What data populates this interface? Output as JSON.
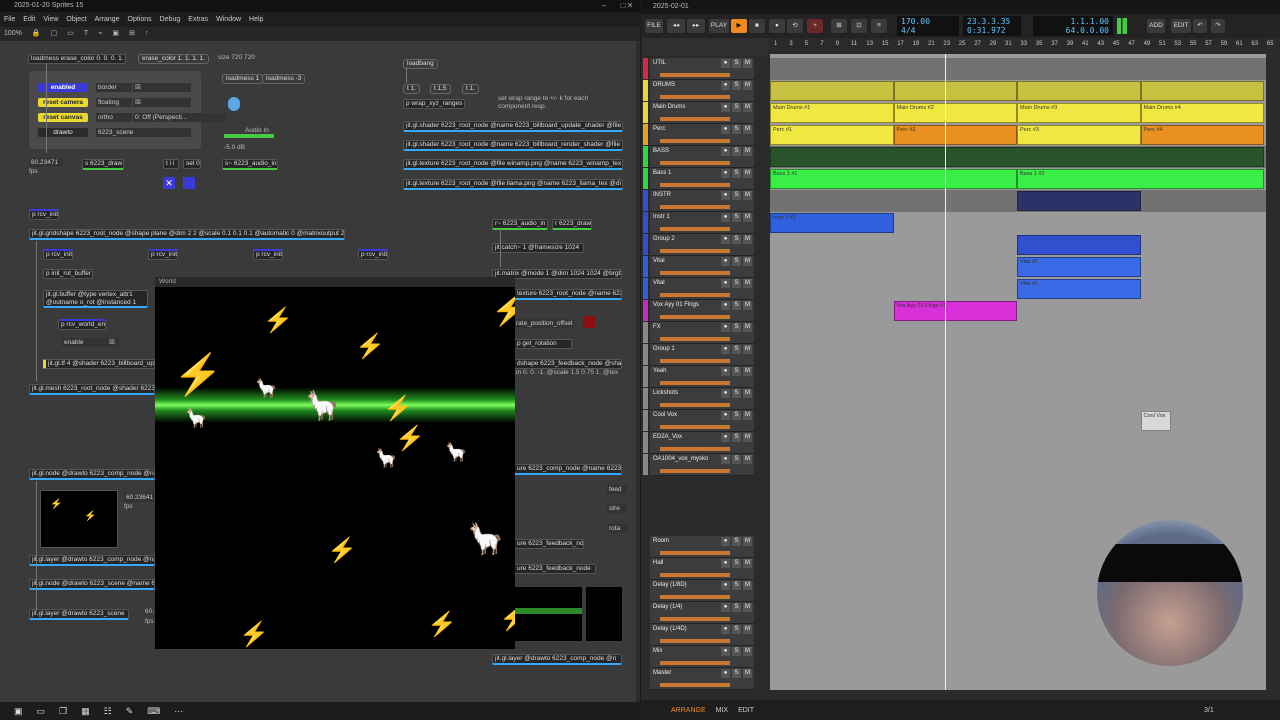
{
  "max": {
    "title": "2025-01-20 Sprites 15",
    "menu": [
      "File",
      "Edit",
      "View",
      "Object",
      "Arrange",
      "Options",
      "Debug",
      "Extras",
      "Window",
      "Help"
    ],
    "zoom": "100%",
    "objects": {
      "loadmess_erase": "loadmess erase_color 0. 0. 0. 1.",
      "erase_color": "erase_color 1. 1. 1. 1.",
      "size": "size 720 720",
      "loadmess1": "loadmess 1",
      "loadmess3": "loadmess -3",
      "loadbang": "loadbang",
      "rng1": "t 1.",
      "rng15": "t 1.5",
      "rng1b": "t 1.",
      "p_wrap": "p wrap_xyz_ranges",
      "wrap_comment": "set wrap range to +/- k for each component resp.",
      "shader_update": "jit.gl.shader 6223_root_node @name 6223_billboard_update_shader @file b",
      "shader_render": "jit.gl.shader 6223_root_node @name 6223_billboard_render_shader @file b",
      "texture_winamp": "jit.gl.texture 6223_root_node @file winamp.png @name 6223_winamp_tex",
      "texture_llama": "jit.gl.texture 6223_root_node @file llama.png @name 6223_llama_tex @di",
      "fps_val": "60.23471",
      "fps_lbl": "fps",
      "s_draw": "s 6223_draw",
      "t_ii": "t i i",
      "sel0": "sel 0",
      "audio_in": "s~ 6223_audio_in",
      "audio_lbl": "Audio In",
      "db": "-5.0 dB",
      "prcv_init": "p rcv_init",
      "gridshape": "jit.gl.gridshape 6223_root_node @shape plane @dim 2 2 @scale 0.1 0.1 0.1 @automatic 0 @matrixoutput 2",
      "prcv_a": "p rcv_init",
      "prcv_b": "p rcv_init",
      "prcv_c": "p rcv_init",
      "prcv_d": "p rcv_init",
      "p_init_rot": "p init_rot_buffer",
      "buffer": "jit.gl.buffer @type vertex_attr1 @outname o_rot @instanced 1",
      "prcv_world": "p rcv_world_en",
      "enable": "enable",
      "gltf": "jit.gl.tf 4 @shader 6223_billboard_upd",
      "mesh": "jit.gl.mesh 6223_root_node @shader 6223_bi",
      "r_audio": "r~ 6223_audio_in",
      "r_draw": "r 6223_draw",
      "catch": "jit.catch~ 1 @framesize 1024",
      "matrix": "jit.matrix @mode 1 @dim 1024 1024 @brgb",
      "texture_root": "texture 6223_root_node @name 6223_t",
      "rate_offset": "rate_position_offset",
      "get_rotation": "p get_rotation",
      "shape_feedback": "dshape 6223_feedback_node @shap",
      "pos_args": "on 0. 0. -1. @scale 1.5 0.75 1. @tex",
      "node_comp": "jit.gl.node @drawto 6223_comp_node @na",
      "node_comp2": "ure 6223_comp_node @name 6223_f",
      "fps2_val": "60.23641",
      "fps2_lbl": "fps",
      "layer_comp": "jit.gl.layer @drawto 6223_comp_node @na",
      "node_scene": "jit.gl.node @drawto 6223_scene @name 6",
      "layer_scene": "jit.gl.layer @drawto 6223_scene",
      "feedback1": "ure 6223_feedback_node",
      "feedback2": "ure 6223_feedback_node",
      "layer_comp2": "jit.gl.layer @drawto 6223_comp_node @n",
      "feed": "feed",
      "stre": "stre",
      "rota": "rota",
      "sixty": "60.",
      "fps3": "fps"
    },
    "panel": {
      "enabled": "enabled",
      "reset_camera": "reset camera",
      "reset_canvas": "reset canvas",
      "drawto": "drawto",
      "border": "border",
      "floating": "floating",
      "ortho": "ortho",
      "ortho_val": "0: Off (Perspecti...",
      "scene": "6223_scene"
    },
    "world_title": "World"
  },
  "bitwig": {
    "title": "2025-02-01",
    "tempo": "170.00",
    "sig": "4/4",
    "pos1": "23.3.3.35",
    "time1": "0:31.972",
    "pos2": "1.1.1.00",
    "pos3": "64.0.0.00",
    "buttons": {
      "file": "FILE",
      "play": "PLAY",
      "add": "ADD",
      "edit": "EDIT"
    },
    "ruler": [
      "1",
      "3",
      "5",
      "7",
      "9",
      "11",
      "13",
      "15",
      "17",
      "19",
      "21",
      "23",
      "25",
      "27",
      "29",
      "31",
      "33",
      "35",
      "37",
      "39",
      "41",
      "43",
      "45",
      "47",
      "49",
      "51",
      "53",
      "55",
      "57",
      "59",
      "61",
      "63",
      "65"
    ],
    "tracks": [
      {
        "name": "UTIL",
        "h": 22,
        "color": "#d8284a"
      },
      {
        "name": "DRUMS",
        "h": 22,
        "color": "#e8d830"
      },
      {
        "name": "Main Drums",
        "h": 22,
        "color": "#e8d830"
      },
      {
        "name": "Perc",
        "h": 22,
        "color": "#e8a020"
      },
      {
        "name": "BASS",
        "h": 22,
        "color": "#2ad840"
      },
      {
        "name": "Bass 1",
        "h": 22,
        "color": "#2ad840"
      },
      {
        "name": "INSTR",
        "h": 22,
        "color": "#3050d0"
      },
      {
        "name": "Instr 1",
        "h": 22,
        "color": "#3050d0"
      },
      {
        "name": "Group 2",
        "h": 22,
        "color": "#3050d0"
      },
      {
        "name": "Vital",
        "h": 22,
        "color": "#3060e0"
      },
      {
        "name": "Vital",
        "h": 22,
        "color": "#3060e0"
      },
      {
        "name": "Vox Ayy 01 Flngs",
        "h": 22,
        "color": "#c828c8"
      },
      {
        "name": "FX",
        "h": 22,
        "color": "#888888"
      },
      {
        "name": "Group 1",
        "h": 22,
        "color": "#888888"
      },
      {
        "name": "Yeah",
        "h": 22,
        "color": "#888888"
      },
      {
        "name": "Lickshots",
        "h": 22,
        "color": "#888888"
      },
      {
        "name": "Cool Vox",
        "h": 22,
        "color": "#888888"
      },
      {
        "name": "ED2A_Vox",
        "h": 22,
        "color": "#888888"
      },
      {
        "name": "OA1004_vox_mysko",
        "h": 22,
        "color": "#888888"
      }
    ],
    "fx_tracks": [
      "Room",
      "Hall",
      "Delay (1/8D)",
      "Delay (1/4)",
      "Delay (1/4D)",
      "Mix",
      "Master"
    ],
    "clips": {
      "md1": "Main Drums #1",
      "md2": "Main Drums #2",
      "md3": "Main Drums #3",
      "md4": "Main Drums #4",
      "p1": "Perc #1",
      "p2": "Perc #2",
      "p3": "Perc #3",
      "p4": "Perc #4",
      "b1": "Bass 1 #1",
      "b2": "Bass 1 #2",
      "i1": "Instr 1 #1",
      "v1": "Vital #1",
      "v2": "Vital #1",
      "vox": "Vox Ayy 01 Flngs #1",
      "cool": "Cool Vox"
    },
    "bottom": [
      "ARRANGE",
      "MIX",
      "EDIT"
    ],
    "page": "3/1"
  }
}
